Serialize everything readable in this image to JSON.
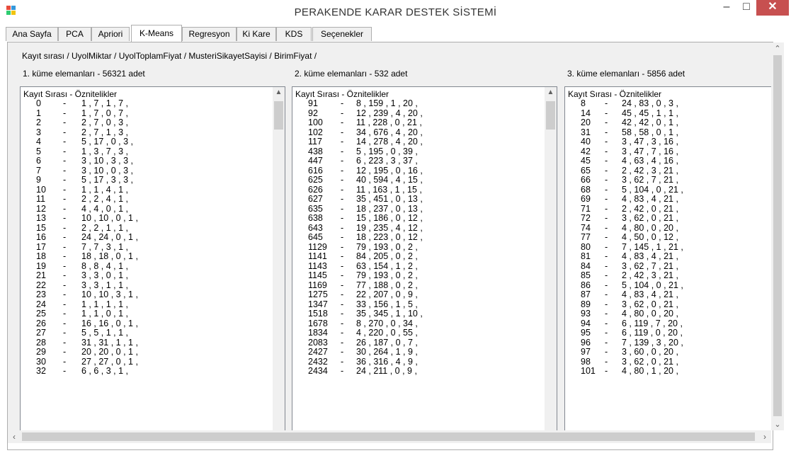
{
  "window": {
    "title": "PERAKENDE KARAR DESTEK SİSTEMİ"
  },
  "tabs": [
    "Ana Sayfa",
    "PCA",
    "Apriori",
    "K-Means",
    "Regresyon",
    "Ki Kare",
    "KDS",
    "Seçenekler"
  ],
  "active_tab": "K-Means",
  "header_line": "Kayıt sırası / UyolMiktar / UyolToplamFiyat / MusteriSikayetSayisi / BirimFiyat /",
  "clusters": [
    {
      "label": "1. küme elemanları - 56321 adet",
      "list_header": "Kayıt Sırası - Öznitelikler",
      "rows": [
        {
          "id": "0",
          "vals": "1 , 7 , 1 , 7 ,"
        },
        {
          "id": "1",
          "vals": "1 , 7 , 0 , 7 ,"
        },
        {
          "id": "2",
          "vals": "2 , 7 , 0 , 3 ,"
        },
        {
          "id": "3",
          "vals": "2 , 7 , 1 , 3 ,"
        },
        {
          "id": "4",
          "vals": "5 , 17 , 0 , 3 ,"
        },
        {
          "id": "5",
          "vals": "1 , 3 , 7 , 3 ,"
        },
        {
          "id": "6",
          "vals": "3 , 10 , 3 , 3 ,"
        },
        {
          "id": "7",
          "vals": "3 , 10 , 0 , 3 ,"
        },
        {
          "id": "9",
          "vals": "5 , 17 , 3 , 3 ,"
        },
        {
          "id": "10",
          "vals": "1 , 1 , 4 , 1 ,"
        },
        {
          "id": "11",
          "vals": "2 , 2 , 4 , 1 ,"
        },
        {
          "id": "12",
          "vals": "4 , 4 , 0 , 1 ,"
        },
        {
          "id": "13",
          "vals": "10 , 10 , 0 , 1 ,"
        },
        {
          "id": "15",
          "vals": "2 , 2 , 1 , 1 ,"
        },
        {
          "id": "16",
          "vals": "24 , 24 , 0 , 1 ,"
        },
        {
          "id": "17",
          "vals": "7 , 7 , 3 , 1 ,"
        },
        {
          "id": "18",
          "vals": "18 , 18 , 0 , 1 ,"
        },
        {
          "id": "19",
          "vals": "8 , 8 , 4 , 1 ,"
        },
        {
          "id": "21",
          "vals": "3 , 3 , 0 , 1 ,"
        },
        {
          "id": "22",
          "vals": "3 , 3 , 1 , 1 ,"
        },
        {
          "id": "23",
          "vals": "10 , 10 , 3 , 1 ,"
        },
        {
          "id": "24",
          "vals": "1 , 1 , 1 , 1 ,"
        },
        {
          "id": "25",
          "vals": "1 , 1 , 0 , 1 ,"
        },
        {
          "id": "26",
          "vals": "16 , 16 , 0 , 1 ,"
        },
        {
          "id": "27",
          "vals": "5 , 5 , 1 , 1 ,"
        },
        {
          "id": "28",
          "vals": "31 , 31 , 1 , 1 ,"
        },
        {
          "id": "29",
          "vals": "20 , 20 , 0 , 1 ,"
        },
        {
          "id": "30",
          "vals": "27 , 27 , 0 , 1 ,"
        },
        {
          "id": "32",
          "vals": "6 , 6 , 3 , 1 ,"
        }
      ]
    },
    {
      "label": "2. küme elemanları - 532 adet",
      "list_header": "Kayıt Sırası - Öznitelikler",
      "rows": [
        {
          "id": "91",
          "vals": "8 , 159 , 1 , 20 ,"
        },
        {
          "id": "92",
          "vals": "12 , 239 , 4 , 20 ,"
        },
        {
          "id": "100",
          "vals": "11 , 228 , 0 , 21 ,"
        },
        {
          "id": "102",
          "vals": "34 , 676 , 4 , 20 ,"
        },
        {
          "id": "117",
          "vals": "14 , 278 , 4 , 20 ,"
        },
        {
          "id": "438",
          "vals": "5 , 195 , 0 , 39 ,"
        },
        {
          "id": "447",
          "vals": "6 , 223 , 3 , 37 ,"
        },
        {
          "id": "616",
          "vals": "12 , 195 , 0 , 16 ,"
        },
        {
          "id": "625",
          "vals": "40 , 594 , 4 , 15 ,"
        },
        {
          "id": "626",
          "vals": "11 , 163 , 1 , 15 ,"
        },
        {
          "id": "627",
          "vals": "35 , 451 , 0 , 13 ,"
        },
        {
          "id": "635",
          "vals": "18 , 237 , 0 , 13 ,"
        },
        {
          "id": "638",
          "vals": "15 , 186 , 0 , 12 ,"
        },
        {
          "id": "643",
          "vals": "19 , 235 , 4 , 12 ,"
        },
        {
          "id": "645",
          "vals": "18 , 223 , 0 , 12 ,"
        },
        {
          "id": "1129",
          "vals": "79 , 193 , 0 , 2 ,"
        },
        {
          "id": "1141",
          "vals": "84 , 205 , 0 , 2 ,"
        },
        {
          "id": "1143",
          "vals": "63 , 154 , 1 , 2 ,"
        },
        {
          "id": "1145",
          "vals": "79 , 193 , 0 , 2 ,"
        },
        {
          "id": "1169",
          "vals": "77 , 188 , 0 , 2 ,"
        },
        {
          "id": "1275",
          "vals": "22 , 207 , 0 , 9 ,"
        },
        {
          "id": "1347",
          "vals": "33 , 156 , 1 , 5 ,"
        },
        {
          "id": "1518",
          "vals": "35 , 345 , 1 , 10 ,"
        },
        {
          "id": "1678",
          "vals": "8 , 270 , 0 , 34 ,"
        },
        {
          "id": "1834",
          "vals": "4 , 220 , 0 , 55 ,"
        },
        {
          "id": "2083",
          "vals": "26 , 187 , 0 , 7 ,"
        },
        {
          "id": "2427",
          "vals": "30 , 264 , 1 , 9 ,"
        },
        {
          "id": "2432",
          "vals": "36 , 316 , 4 , 9 ,"
        },
        {
          "id": "2434",
          "vals": "24 , 211 , 0 , 9 ,"
        }
      ]
    },
    {
      "label": "3. küme elemanları - 5856 adet",
      "list_header": "Kayıt Sırası - Öznitelikler",
      "rows": [
        {
          "id": "8",
          "vals": "24 , 83 , 0 , 3 ,"
        },
        {
          "id": "14",
          "vals": "45 , 45 , 1 , 1 ,"
        },
        {
          "id": "20",
          "vals": "42 , 42 , 0 , 1 ,"
        },
        {
          "id": "31",
          "vals": "58 , 58 , 0 , 1 ,"
        },
        {
          "id": "40",
          "vals": "3 , 47 , 3 , 16 ,"
        },
        {
          "id": "42",
          "vals": "3 , 47 , 7 , 16 ,"
        },
        {
          "id": "45",
          "vals": "4 , 63 , 4 , 16 ,"
        },
        {
          "id": "65",
          "vals": "2 , 42 , 3 , 21 ,"
        },
        {
          "id": "66",
          "vals": "3 , 62 , 7 , 21 ,"
        },
        {
          "id": "68",
          "vals": "5 , 104 , 0 , 21 ,"
        },
        {
          "id": "69",
          "vals": "4 , 83 , 4 , 21 ,"
        },
        {
          "id": "71",
          "vals": "2 , 42 , 0 , 21 ,"
        },
        {
          "id": "72",
          "vals": "3 , 62 , 0 , 21 ,"
        },
        {
          "id": "74",
          "vals": "4 , 80 , 0 , 20 ,"
        },
        {
          "id": "77",
          "vals": "4 , 50 , 0 , 12 ,"
        },
        {
          "id": "80",
          "vals": "7 , 145 , 1 , 21 ,"
        },
        {
          "id": "81",
          "vals": "4 , 83 , 4 , 21 ,"
        },
        {
          "id": "84",
          "vals": "3 , 62 , 7 , 21 ,"
        },
        {
          "id": "85",
          "vals": "2 , 42 , 3 , 21 ,"
        },
        {
          "id": "86",
          "vals": "5 , 104 , 0 , 21 ,"
        },
        {
          "id": "87",
          "vals": "4 , 83 , 4 , 21 ,"
        },
        {
          "id": "89",
          "vals": "3 , 62 , 0 , 21 ,"
        },
        {
          "id": "93",
          "vals": "4 , 80 , 0 , 20 ,"
        },
        {
          "id": "94",
          "vals": "6 , 119 , 7 , 20 ,"
        },
        {
          "id": "95",
          "vals": "6 , 119 , 0 , 20 ,"
        },
        {
          "id": "96",
          "vals": "7 , 139 , 3 , 20 ,"
        },
        {
          "id": "97",
          "vals": "3 , 60 , 0 , 20 ,"
        },
        {
          "id": "98",
          "vals": "3 , 62 , 0 , 21 ,"
        },
        {
          "id": "101",
          "vals": "4 , 80 , 1 , 20 ,"
        }
      ]
    }
  ],
  "icons": {
    "app": "app-icon",
    "minimize": "minimize-icon",
    "maximize": "maximize-icon",
    "close": "close-icon"
  },
  "colors": {
    "close_button": "#c75050",
    "tab_bg": "#f0f0f0",
    "panel_bg": "#f0f0f0"
  }
}
